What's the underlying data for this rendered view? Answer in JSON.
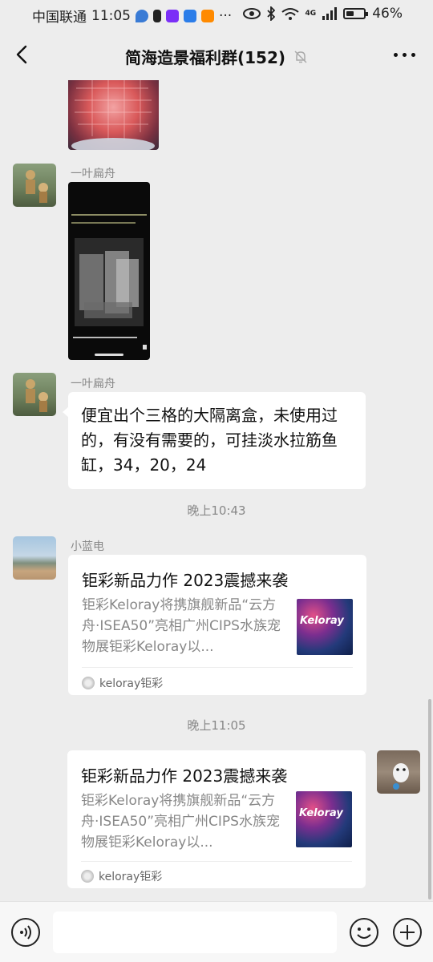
{
  "status_bar": {
    "carrier": "中国联通",
    "time": "11:05",
    "ellipsis": "···",
    "network": "4G",
    "battery": "46%",
    "battery_level": 0.46
  },
  "header": {
    "title": "简海造景福利群(152)"
  },
  "messages": {
    "m2": {
      "sender": "一叶扁舟"
    },
    "m3": {
      "sender": "一叶扁舟",
      "text": "便宜出个三格的大隔离盒，未使用过的，有没有需要的，可挂淡水拉筋鱼缸，34，20，24"
    },
    "time1": "晚上10:43",
    "m4": {
      "sender": "小蓝电",
      "title": "钜彩新品力作 2023震撼来袭",
      "desc": "钜彩Keloray将携旗舰新品“云方舟·ISEA50”亮相广州CIPS水族宠物展钜彩Keloray以...",
      "thumb_text": "Keloray",
      "source": "keloray钜彩"
    },
    "time2": "晚上11:05",
    "m5": {
      "title": "钜彩新品力作 2023震撼来袭",
      "desc": "钜彩Keloray将携旗舰新品“云方舟·ISEA50”亮相广州CIPS水族宠物展钜彩Keloray以...",
      "thumb_text": "Keloray",
      "source": "keloray钜彩"
    }
  },
  "input": {
    "placeholder": ""
  },
  "colors": {
    "background": "#ededed",
    "bubble": "#ffffff",
    "muted_text": "#888888"
  }
}
